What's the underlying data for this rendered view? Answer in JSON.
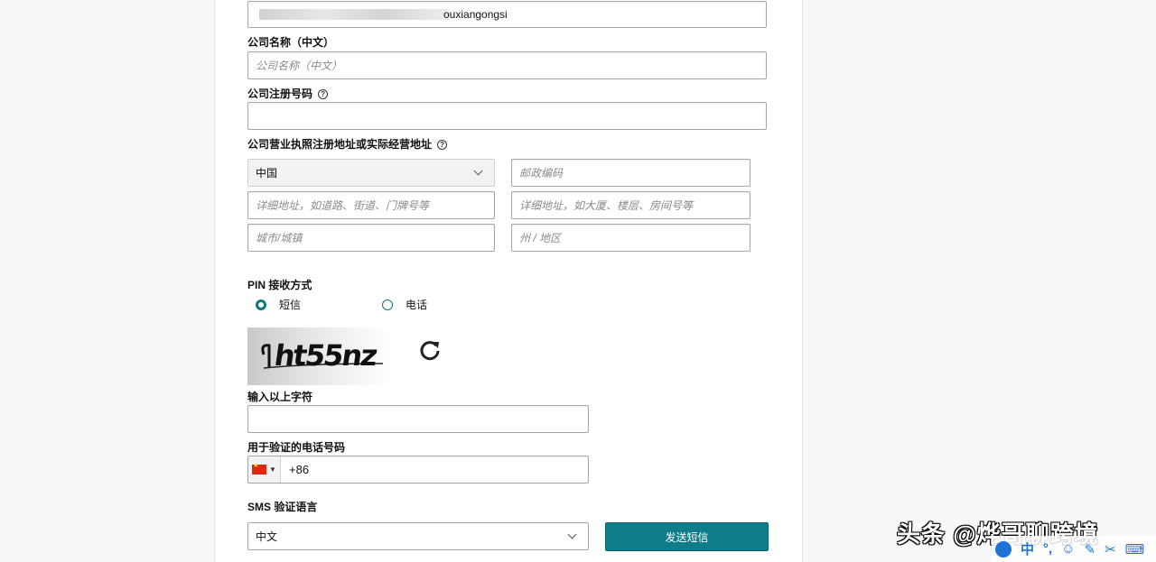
{
  "company_name_en": {
    "value_visible": "ouxiangongsi"
  },
  "company_name_cn": {
    "label": "公司名称（中文）",
    "placeholder": "公司名称（中文）"
  },
  "company_reg_no": {
    "label": "公司注册号码",
    "help": "?",
    "value": ""
  },
  "address": {
    "label": "公司营业执照注册地址或实际经营地址",
    "help": "?",
    "country": "中国",
    "postcode_placeholder": "邮政编码",
    "street_placeholder": "详细地址，如道路、街道、门牌号等",
    "building_placeholder": "详细地址，如大厦、楼层、房间号等",
    "city_placeholder": "城市/城镇",
    "state_placeholder": "州 / 地区"
  },
  "pin": {
    "label": "PIN 接收方式",
    "options": [
      {
        "label": "短信",
        "selected": true
      },
      {
        "label": "电话",
        "selected": false
      }
    ]
  },
  "captcha": {
    "text": "ht55nz",
    "input_label": "输入以上字符",
    "value": ""
  },
  "phone": {
    "label": "用于验证的电话号码",
    "country_code": "+86"
  },
  "sms_language": {
    "label": "SMS 验证语言",
    "selected": "中文"
  },
  "send_button": {
    "label": "发送短信"
  },
  "watermark": {
    "text": "头条 @烨哥聊跨境"
  },
  "tray": {
    "ime": "中"
  },
  "colors": {
    "accent": "#0f7c8a",
    "radio": "#0a7a7f"
  }
}
